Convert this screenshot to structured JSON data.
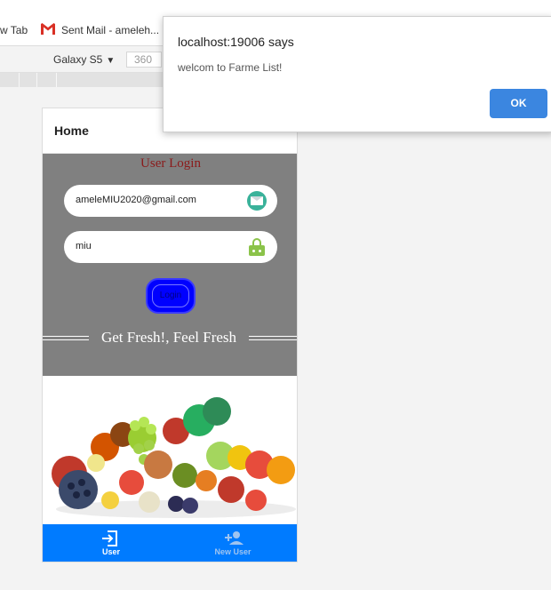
{
  "browser": {
    "bookmarks": [
      {
        "label": "w Tab"
      },
      {
        "label": "Sent Mail - ameleh..."
      }
    ],
    "device_toolbar": {
      "device": "Galaxy S5",
      "width": "360"
    }
  },
  "app": {
    "header_title": "Home",
    "login": {
      "title": "User Login",
      "email_value": "ameleMIU2020@gmail.com",
      "password_value": "miu",
      "button_label": "Login"
    },
    "tagline": "Get Fresh!, Feel Fresh",
    "tabs": [
      {
        "label": "User",
        "icon": "login-icon",
        "active": true
      },
      {
        "label": "New User",
        "icon": "add-user-icon",
        "active": false
      }
    ],
    "colors": {
      "login_panel": "#808080",
      "title_red": "#8b1a1a",
      "tabbar": "#007bff",
      "login_button": "#0000ff"
    }
  },
  "dialog": {
    "title": "localhost:19006 says",
    "message": "welcom to Farme List!",
    "ok_label": "OK"
  }
}
